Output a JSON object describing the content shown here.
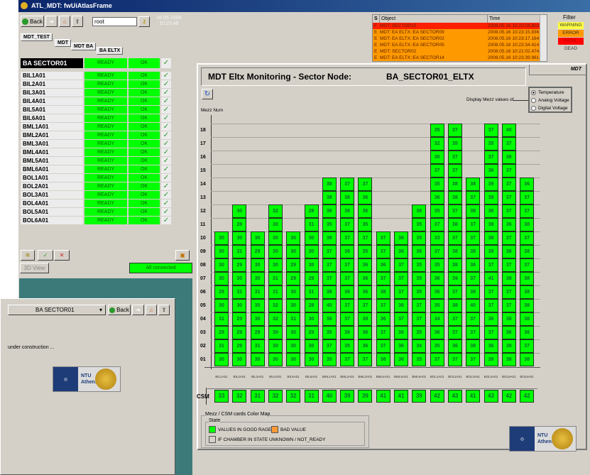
{
  "window": {
    "title": "ATL_MDT: fwUiAtlasFrame"
  },
  "nav": {
    "back": "Back",
    "path_value": "root",
    "date": "16-05-2008",
    "time": "10:23:48"
  },
  "breadcrumbs": [
    "MDT_TEST",
    "MDT",
    "MDT BA",
    "BA ELTX"
  ],
  "node": {
    "name": "BA SECTOR01",
    "state": "READY",
    "status": "OK"
  },
  "chambers": [
    {
      "name": "BIL1A01",
      "state": "READY",
      "status": "OK"
    },
    {
      "name": "BIL2A01",
      "state": "READY",
      "status": "OK"
    },
    {
      "name": "BIL3A01",
      "state": "READY",
      "status": "OK"
    },
    {
      "name": "BIL4A01",
      "state": "READY",
      "status": "OK"
    },
    {
      "name": "BIL5A01",
      "state": "READY",
      "status": "OK"
    },
    {
      "name": "BIL6A01",
      "state": "READY",
      "status": "OK"
    },
    {
      "name": "BML1A01",
      "state": "READY",
      "status": "OK"
    },
    {
      "name": "BML2A01",
      "state": "READY",
      "status": "OK"
    },
    {
      "name": "BML3A01",
      "state": "READY",
      "status": "OK"
    },
    {
      "name": "BML4A01",
      "state": "READY",
      "status": "OK"
    },
    {
      "name": "BML5A01",
      "state": "READY",
      "status": "OK"
    },
    {
      "name": "BML6A01",
      "state": "READY",
      "status": "OK"
    },
    {
      "name": "BOL1A01",
      "state": "READY",
      "status": "OK"
    },
    {
      "name": "BOL2A01",
      "state": "READY",
      "status": "OK"
    },
    {
      "name": "BOL3A01",
      "state": "READY",
      "status": "OK"
    },
    {
      "name": "BOL4A01",
      "state": "READY",
      "status": "OK"
    },
    {
      "name": "BOL5A01",
      "state": "READY",
      "status": "OK"
    },
    {
      "name": "BOL6A01",
      "state": "READY",
      "status": "OK"
    }
  ],
  "left_tools": {
    "view3d": "3D View",
    "connection": "All connected"
  },
  "alarms": {
    "headers": [
      "S",
      "Object",
      "Time"
    ],
    "rows": [
      {
        "s": "F",
        "object": "MDT: SECTOR10",
        "time": "2008.05.16 10:23:04.803",
        "color": "#ff2000"
      },
      {
        "s": "E",
        "object": "MDT: EA ELTX::EA SECTOR09",
        "time": "2008.05.16 10:23:15.836",
        "color": "#ff9900"
      },
      {
        "s": "E",
        "object": "MDT: EA ELTX::EA SECTOR02",
        "time": "2008.05.16 10:23:17.164",
        "color": "#ff9900"
      },
      {
        "s": "E",
        "object": "MDT: EA ELTX::EA SECTOR05",
        "time": "2008.05.16 10:23:34.414",
        "color": "#ff9900"
      },
      {
        "s": "E",
        "object": "MDT: SECTOR02",
        "time": "2008.05.16 10:21:02.474",
        "color": "#ff9900"
      },
      {
        "s": "E",
        "object": "MDT: EA ELTX::EA SECTOR14",
        "time": "2008.05.16 10:23:39.961",
        "color": "#ff9900"
      }
    ]
  },
  "filter": {
    "title": "Filter",
    "items": [
      {
        "label": "WARNING",
        "color": "#ffff40"
      },
      {
        "label": "ERROR",
        "color": "#ff9900"
      },
      {
        "label": "FATAL",
        "color": "#ff0000"
      },
      {
        "label": "DEAD",
        "color": "#d4d0c8"
      }
    ]
  },
  "panel": {
    "tab": "MDT",
    "title": "MDT Eltx Monitoring  - Sector Node:",
    "node": "BA_SECTOR01_ELTX",
    "display_label": "Display Mezz values of",
    "options": [
      "Temperature",
      "Analog Voltage",
      "Digital Voltage"
    ],
    "selected": "Temperature",
    "y_axis_label": "Mezz Num",
    "csm_label": "CSM"
  },
  "rows": [
    "01",
    "02",
    "03",
    "04",
    "05",
    "06",
    "07",
    "08",
    "09",
    "10",
    "11",
    "12",
    "13",
    "14",
    "15",
    "16",
    "17",
    "18"
  ],
  "columns": [
    {
      "name": "BIL1A01",
      "csm": 33,
      "values": [
        30,
        31,
        29,
        31,
        30,
        29,
        30,
        30,
        30,
        30
      ]
    },
    {
      "name": "BIL2A01",
      "csm": 32,
      "values": [
        30,
        29,
        29,
        29,
        30,
        31,
        30,
        29,
        31,
        30,
        28,
        30
      ]
    },
    {
      "name": "BIL3A01",
      "csm": 31,
      "values": [
        30,
        31,
        29,
        30,
        30,
        31,
        30,
        30,
        29,
        30
      ]
    },
    {
      "name": "BIL4A01",
      "csm": 32,
      "values": [
        30,
        30,
        30,
        32,
        32,
        31,
        31,
        30,
        30,
        30,
        30,
        32
      ]
    },
    {
      "name": "BIL5A01",
      "csm": 32,
      "values": [
        30,
        30,
        30,
        31,
        30,
        30,
        29,
        29,
        30,
        30
      ]
    },
    {
      "name": "BIL6A01",
      "csm": 31,
      "values": [
        30,
        30,
        29,
        30,
        28,
        31,
        29,
        30,
        30,
        30,
        31,
        28
      ]
    },
    {
      "name": "BML1A01",
      "csm": 40,
      "values": [
        35,
        37,
        35,
        36,
        40,
        38,
        37,
        37,
        37,
        38,
        35,
        36,
        38,
        38
      ]
    },
    {
      "name": "BML2A01",
      "csm": 39,
      "values": [
        37,
        35,
        36,
        37,
        37,
        36,
        37,
        37,
        36,
        37,
        37,
        36,
        36,
        37
      ]
    },
    {
      "name": "BML3A01",
      "csm": 39,
      "values": [
        37,
        36,
        36,
        38,
        37,
        36,
        36,
        36,
        35,
        37,
        35,
        36,
        36,
        37
      ]
    },
    {
      "name": "BML4A01",
      "csm": 41,
      "values": [
        38,
        37,
        37,
        36,
        37,
        38,
        37,
        36,
        37,
        37
      ]
    },
    {
      "name": "BML5A01",
      "csm": 41,
      "values": [
        36,
        36,
        36,
        37,
        36,
        37,
        37,
        37,
        36,
        36
      ]
    },
    {
      "name": "BML6A01",
      "csm": 39,
      "values": [
        35,
        34,
        35,
        37,
        37,
        35,
        35,
        35,
        36,
        35,
        35,
        36
      ]
    },
    {
      "name": "BOL1A01",
      "csm": 42,
      "values": [
        37,
        35,
        36,
        34,
        35,
        36,
        36,
        35,
        37,
        33,
        37,
        35,
        36,
        35,
        37,
        35,
        32,
        35
      ]
    },
    {
      "name": "BOL2A01",
      "csm": 43,
      "values": [
        37,
        36,
        37,
        37,
        38,
        37,
        39,
        38,
        38,
        37,
        38,
        37,
        38,
        38,
        37,
        37,
        35,
        37
      ]
    },
    {
      "name": "BOL3A01",
      "csm": 41,
      "values": [
        37,
        38,
        37,
        37,
        40,
        38,
        37,
        36,
        38,
        37,
        37,
        38,
        37,
        38
      ]
    },
    {
      "name": "BOL4A01",
      "csm": 43,
      "values": [
        38,
        36,
        37,
        36,
        37,
        37,
        41,
        37,
        39,
        38,
        38,
        36,
        39,
        39,
        36,
        37,
        35,
        37
      ]
    },
    {
      "name": "BOL5A01",
      "csm": 42,
      "values": [
        38,
        38,
        36,
        36,
        37,
        37,
        38,
        37,
        38,
        37,
        36,
        37,
        37,
        37,
        37,
        36,
        37,
        40
      ]
    },
    {
      "name": "BOL6A01",
      "csm": 42,
      "values": [
        38,
        37,
        36,
        38,
        38,
        38,
        38,
        37,
        38,
        37,
        38,
        37,
        37,
        36
      ]
    }
  ],
  "legend": {
    "title": "Mezz / CSM cards Color Map",
    "group": "State",
    "items": [
      {
        "label": "VALUES IN GOOD RAGE",
        "color": "#00ff00"
      },
      {
        "label": "BAD VALUE",
        "color": "#ff9933"
      },
      {
        "label": "IF CHAMBER IN STATE UNKNOWN  / NOT_READY",
        "color": "#d4d0c8"
      }
    ]
  },
  "logo": {
    "cern": "CERN",
    "ntu": "NTU",
    "athens": "Athens"
  },
  "popup": {
    "selector": "BA SECTOR01",
    "back": "Back",
    "message": "under construction ..."
  },
  "colors": {
    "good": "#00ff00",
    "teal": "#3c7a7a",
    "window": "#d4d0c8"
  }
}
